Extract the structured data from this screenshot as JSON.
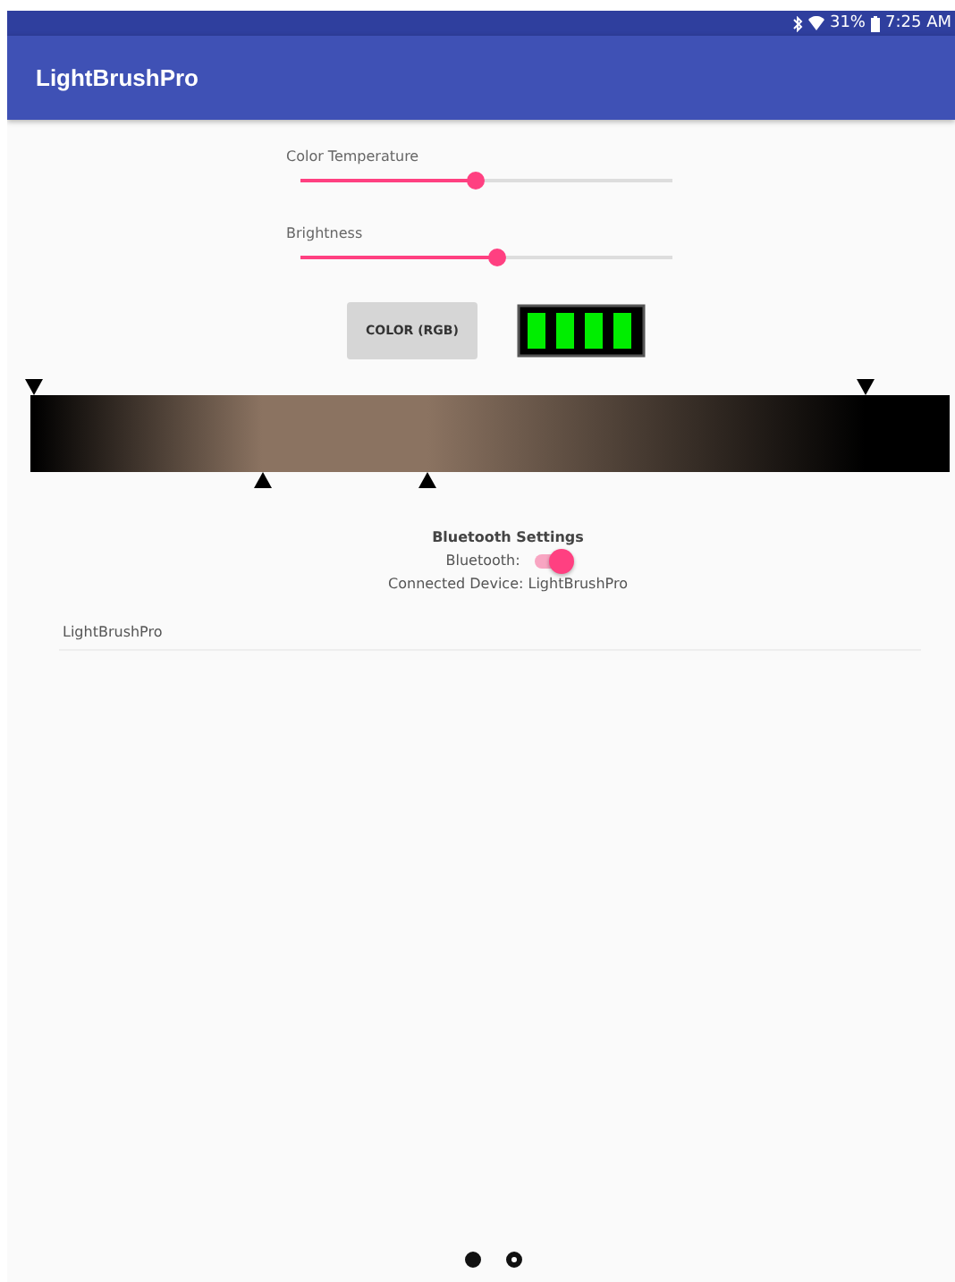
{
  "status_bar": {
    "battery": "31%",
    "time": "7:25 AM"
  },
  "app_bar": {
    "title": "LightBrushPro"
  },
  "sliders": [
    {
      "label": "Color Temperature",
      "level": 0.47
    },
    {
      "label": "Brightness",
      "level": 0.53
    }
  ],
  "color_button": {
    "label": "COLOR (RGB)"
  },
  "gradient": {
    "markers": [
      {
        "kind": "top",
        "level": 0.004
      },
      {
        "kind": "bottom",
        "level": 0.252
      },
      {
        "kind": "bottom",
        "level": 0.432
      },
      {
        "kind": "top",
        "level": 0.908
      }
    ]
  },
  "bluetooth": {
    "heading": "Bluetooth Settings",
    "label": "Bluetooth:",
    "on": true,
    "connected": "Connected Device: LightBrushPro"
  },
  "devices": [
    "LightBrushPro"
  ],
  "pages": [
    {
      "selected": true
    },
    {
      "selected": false
    }
  ]
}
